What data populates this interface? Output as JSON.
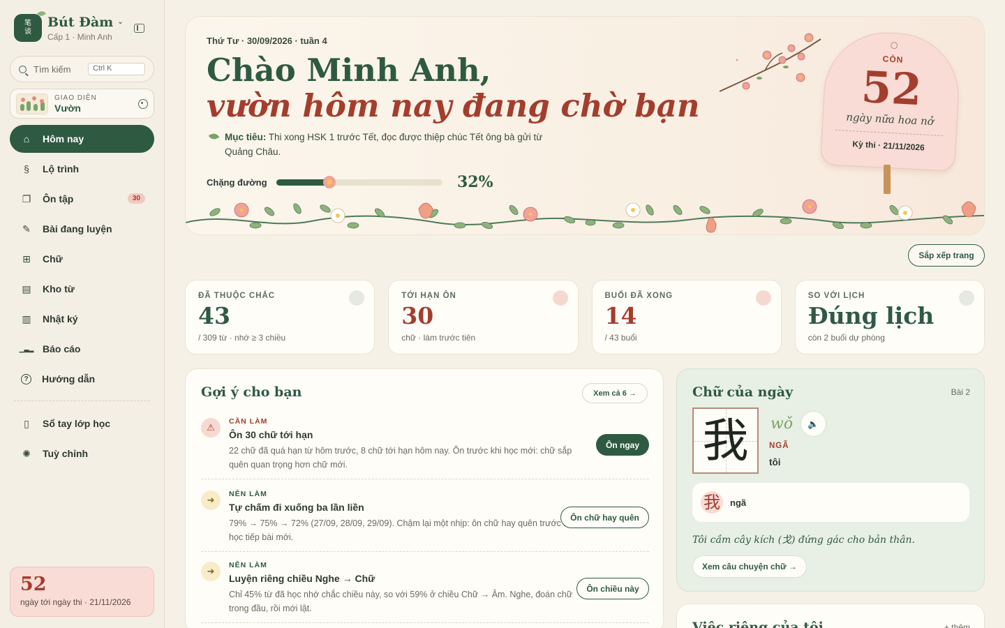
{
  "brand": {
    "logo_top": "笔",
    "logo_bottom": "谈",
    "name": "Bút Đàm",
    "chevron": "⌄",
    "subtitle": "Cấp 1 · Minh Anh"
  },
  "search": {
    "placeholder": "Tìm kiếm",
    "shortcut": "Ctrl K"
  },
  "theme": {
    "kicker": "GIAO DIỆN",
    "value": "Vườn"
  },
  "nav": [
    {
      "label": "Hôm nay",
      "icon": "home-icon",
      "glyph": "⌂"
    },
    {
      "label": "Lộ trình",
      "icon": "route-icon",
      "glyph": "§"
    },
    {
      "label": "Ôn tập",
      "icon": "cards-icon",
      "glyph": "❐",
      "badge": "30"
    },
    {
      "label": "Bài đang luyện",
      "icon": "pencil-icon",
      "glyph": "✎"
    },
    {
      "label": "Chữ",
      "icon": "grid-icon",
      "glyph": "⊞"
    },
    {
      "label": "Kho từ",
      "icon": "book-icon",
      "glyph": "▤"
    },
    {
      "label": "Nhật ký",
      "icon": "journal-icon",
      "glyph": "▥"
    },
    {
      "label": "Báo cáo",
      "icon": "chart-icon",
      "glyph": "▁▃▂"
    },
    {
      "label": "Hướng dẫn",
      "icon": "help-icon",
      "glyph": "?"
    }
  ],
  "nav2": [
    {
      "label": "Sổ tay lớp học",
      "icon": "notebook-icon",
      "glyph": "▯"
    },
    {
      "label": "Tuỳ chỉnh",
      "icon": "gear-icon",
      "glyph": "✺"
    }
  ],
  "countdown": {
    "number": "52",
    "text": "ngày tới ngày thi · 21/11/2026"
  },
  "hero": {
    "date": "Thứ Tư · 30/09/2026 · tuần 4",
    "greeting": "Chào Minh Anh,",
    "tagline": "vườn hôm nay đang chờ bạn",
    "goal_label": "Mục tiêu:",
    "goal_text": " Thi xong HSK 1 trước Tết, đọc được thiệp chúc Tết ông bà gửi từ Quảng Châu.",
    "progress_label": "Chặng đường",
    "progress_value": "32%",
    "progress_fraction": 0.32
  },
  "tag": {
    "kicker": "CÒN",
    "number": "52",
    "caption": "ngày nữa hoa nở",
    "date": "Kỳ thi · 21/11/2026"
  },
  "sort_label": "Sắp xếp trang",
  "stats": [
    {
      "kicker": "ĐÃ THUỘC CHẮC",
      "value": "43",
      "sub": "/ 309 từ · nhớ ≥ 3 chiều",
      "tone": "green"
    },
    {
      "kicker": "TỚI HẠN ÔN",
      "value": "30",
      "sub": "chữ · làm trước tiên",
      "tone": "red"
    },
    {
      "kicker": "BUỔI ĐÃ XONG",
      "value": "14",
      "sub": "/ 43 buổi",
      "tone": "red"
    },
    {
      "kicker": "SO VỚI LỊCH",
      "value": "Đúng lịch",
      "sub": "còn 2 buổi dự phòng",
      "tone": "green"
    }
  ],
  "suggestions": {
    "title": "Gợi ý cho bạn",
    "see_all": "Xem cả 6 →",
    "items": [
      {
        "kicker": "CẦN LÀM",
        "title": "Ôn 30 chữ tới hạn",
        "desc": "22 chữ đã quá hạn từ hôm trước, 8 chữ tới hạn hôm nay. Ôn trước khi học mới: chữ sắp quên quan trọng hơn chữ mới.",
        "button": "Ôn ngay",
        "icon": "warning-icon",
        "glyph": "⚠"
      },
      {
        "kicker": "NÊN LÀM",
        "title": "Tự chấm đi xuống ba lần liền",
        "desc": "79% → 75% → 72% (27/09, 28/09, 29/09). Chậm lại một nhịp: ôn chữ hay quên trước khi học tiếp bài mới.",
        "button": "Ôn chữ hay quên",
        "icon": "arrow-circle-icon",
        "glyph": "➜"
      },
      {
        "kicker": "NÊN LÀM",
        "title": "Luyện riêng chiều Nghe → Chữ",
        "desc": "Chỉ 45% từ đã học nhớ chắc chiều này, so với 59% ở chiều Chữ → Âm. Nghe, đoán chữ trong đầu, rồi mới lật.",
        "button": "Ôn chiều này",
        "icon": "arrow-circle-icon",
        "glyph": "➜"
      }
    ]
  },
  "char_of_day": {
    "title": "Chữ của ngày",
    "lesson": "Bài 2",
    "char": "我",
    "pinyin": "wǒ",
    "hanviet": "NGÃ",
    "meaning": "tôi",
    "component_char": "我",
    "component_label": "ngã",
    "story": "Tôi cầm cây kích (戈) đứng gác cho bản thân.",
    "story_button": "Xem câu chuyện chữ →"
  },
  "private": {
    "title": "Việc riêng của tôi",
    "add": "+ thêm"
  },
  "colors": {
    "primary": "#2f5a42",
    "accent": "#a43d2d",
    "background": "#f6f1e7",
    "blush": "#f9dcd6"
  }
}
